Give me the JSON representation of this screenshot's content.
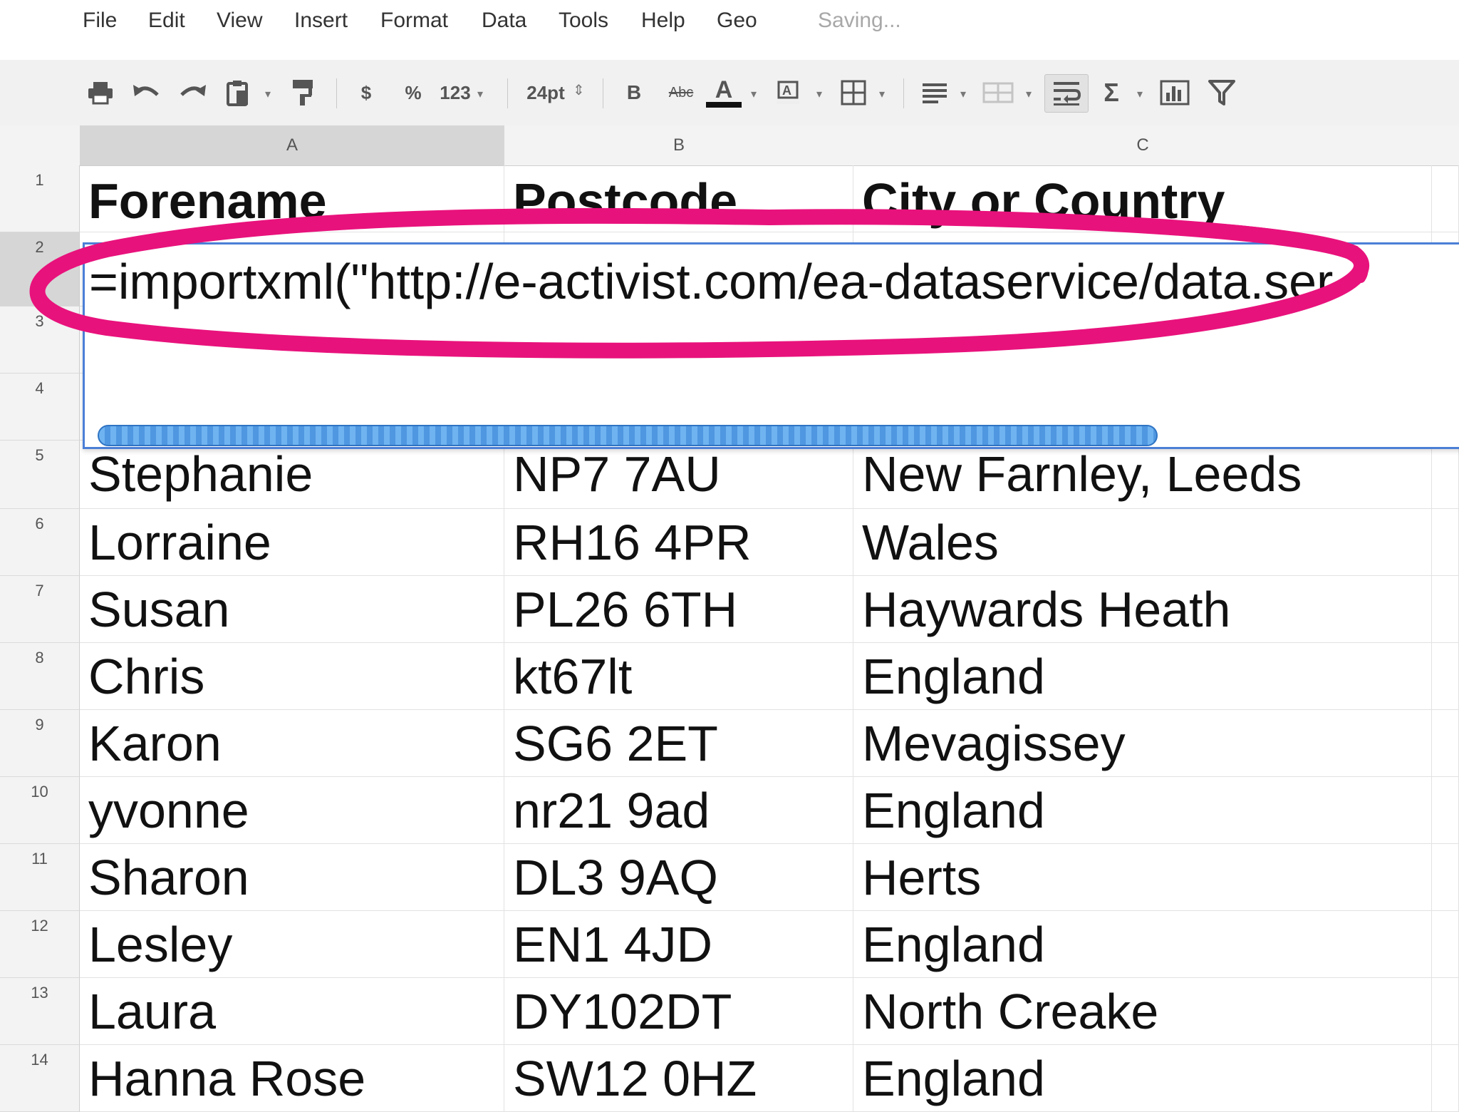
{
  "menu": {
    "items": [
      "File",
      "Edit",
      "View",
      "Insert",
      "Format",
      "Data",
      "Tools",
      "Help",
      "Geo"
    ],
    "status": "Saving..."
  },
  "toolbar": {
    "currency": "$",
    "percent": "%",
    "number_format": "123",
    "font_size": "24pt",
    "bold": "B",
    "strike": "Abc",
    "text_color": "A",
    "sum": "Σ"
  },
  "columns": [
    "A",
    "B",
    "C"
  ],
  "rows": [
    {
      "num": "1",
      "cells": [
        "Forename",
        "Postcode",
        "City or Country"
      ]
    },
    {
      "num": "2",
      "cells": [
        "",
        "",
        ""
      ]
    },
    {
      "num": "3",
      "cells": [
        "",
        "",
        ""
      ]
    },
    {
      "num": "4",
      "cells": [
        "",
        "",
        ""
      ]
    },
    {
      "num": "5",
      "cells": [
        "Stephanie",
        "NP7 7AU",
        "New Farnley, Leeds"
      ]
    },
    {
      "num": "6",
      "cells": [
        "Lorraine",
        "RH16 4PR",
        "Wales"
      ]
    },
    {
      "num": "7",
      "cells": [
        "Susan",
        "PL26 6TH",
        "Haywards Heath"
      ]
    },
    {
      "num": "8",
      "cells": [
        "Chris",
        "kt67lt",
        "England"
      ]
    },
    {
      "num": "9",
      "cells": [
        "Karon",
        "SG6 2ET",
        "Mevagissey"
      ]
    },
    {
      "num": "10",
      "cells": [
        "yvonne",
        "nr21 9ad",
        "England"
      ]
    },
    {
      "num": "11",
      "cells": [
        "Sharon",
        "DL3 9AQ",
        "Herts"
      ]
    },
    {
      "num": "12",
      "cells": [
        "Lesley",
        "EN1 4JD",
        "England"
      ]
    },
    {
      "num": "13",
      "cells": [
        "Laura",
        "DY102DT",
        "North Creake"
      ]
    },
    {
      "num": "14",
      "cells": [
        "Hanna Rose",
        "SW12 0HZ",
        "England"
      ]
    }
  ],
  "editor": {
    "formula": "=importxml(\"http://e-activist.com/ea-dataservice/data.ser",
    "progress": 1.0
  },
  "colors": {
    "highlight": "#e8127c",
    "selection": "#4b7fd6",
    "progress": "#4f97e0"
  }
}
